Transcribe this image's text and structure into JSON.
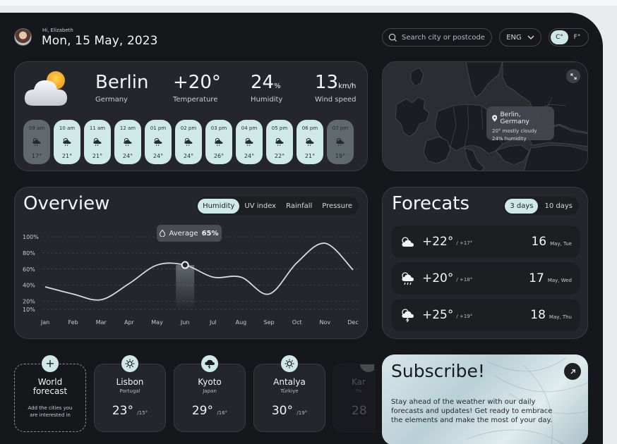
{
  "header": {
    "greeting": "Hi, Elizabeth",
    "date": "Mon, 15 May, 2023",
    "search_placeholder": "Search city or postcode",
    "language": "ENG",
    "unit_c": "C°",
    "unit_f": "F°"
  },
  "current": {
    "city": "Berlin",
    "country": "Germany",
    "temperature": "+20°",
    "temperature_label": "Temperature",
    "humidity": "24",
    "humidity_unit": "%",
    "humidity_label": "Humidity",
    "wind": "13",
    "wind_unit": "km/h",
    "wind_label": "Wind speed",
    "hourly": [
      {
        "time": "09 am",
        "temp": "17°"
      },
      {
        "time": "10 am",
        "temp": "21°"
      },
      {
        "time": "11 am",
        "temp": "21°"
      },
      {
        "time": "12 am",
        "temp": "24°"
      },
      {
        "time": "01 pm",
        "temp": "24°"
      },
      {
        "time": "02 pm",
        "temp": "24°"
      },
      {
        "time": "03 pm",
        "temp": "26°"
      },
      {
        "time": "04 pm",
        "temp": "24°"
      },
      {
        "time": "05 pm",
        "temp": "22°"
      },
      {
        "time": "06 pm",
        "temp": "21°"
      },
      {
        "time": "07 pm",
        "temp": "19°"
      }
    ]
  },
  "map": {
    "pin_city": "Berlin, Germany",
    "pin_line2": "20° mostly cloudy",
    "pin_line3": "24% humidity"
  },
  "overview": {
    "title": "Overview",
    "tabs": [
      "Humidity",
      "UV index",
      "Rainfall",
      "Pressure"
    ],
    "tooltip_label": "Average",
    "tooltip_value": "65%"
  },
  "chart_data": {
    "type": "line",
    "title": "",
    "x": [
      "Jan",
      "Feb",
      "Mar",
      "Apr",
      "May",
      "Jun",
      "Jul",
      "Aug",
      "Sep",
      "Oct",
      "Nov",
      "Dec"
    ],
    "yticks": [
      "100%",
      "80%",
      "60%",
      "40%",
      "20%",
      "10%"
    ],
    "ylim": [
      0,
      100
    ],
    "series": [
      {
        "values": [
          38,
          29,
          22,
          42,
          65,
          65,
          50,
          50,
          29,
          68,
          92,
          59
        ]
      }
    ],
    "highlight": {
      "x": "Jun",
      "y": 65
    }
  },
  "forecasts": {
    "title": "Forecats",
    "tabs": [
      "3 days",
      "10 days"
    ],
    "rows": [
      {
        "temp": "+22°",
        "low": "/ +17°",
        "day": "16",
        "month": "May, Tue",
        "icon": "partly-cloudy-icon"
      },
      {
        "temp": "+20°",
        "low": "/ +18°",
        "day": "17",
        "month": "May, Wed",
        "icon": "rain-sun-icon"
      },
      {
        "temp": "+25°",
        "low": "/ +19°",
        "day": "18",
        "month": "May, Thu",
        "icon": "storm-sun-icon"
      }
    ]
  },
  "world": {
    "title_line1": "World",
    "title_line2": "forecast",
    "sub_line1": "Add the cities you",
    "sub_line2": "are interested in"
  },
  "cities": [
    {
      "name": "Lisbon",
      "country": "Portugal",
      "temp": "23°",
      "low": "/15°",
      "icon": "sun-icon"
    },
    {
      "name": "Kyoto",
      "country": "Japan",
      "temp": "29°",
      "low": "/16°",
      "icon": "storm-cloud-icon"
    },
    {
      "name": "Antalya",
      "country": "Türkiye",
      "temp": "30°",
      "low": "/19°",
      "icon": "sun-icon"
    },
    {
      "name": "Kar",
      "country": "Pa",
      "temp": "28",
      "low": "",
      "icon": "cloud-icon"
    }
  ],
  "subscribe": {
    "title": "Subscribe!",
    "body": "Stay ahead of the weather with our daily forecasts and updates! Get ready to embrace the elements and make the most of your day."
  },
  "colors": {
    "background": "#16171b",
    "card": "#25262b",
    "accent": "#cfe9e6",
    "text": "#f4f5f7"
  }
}
